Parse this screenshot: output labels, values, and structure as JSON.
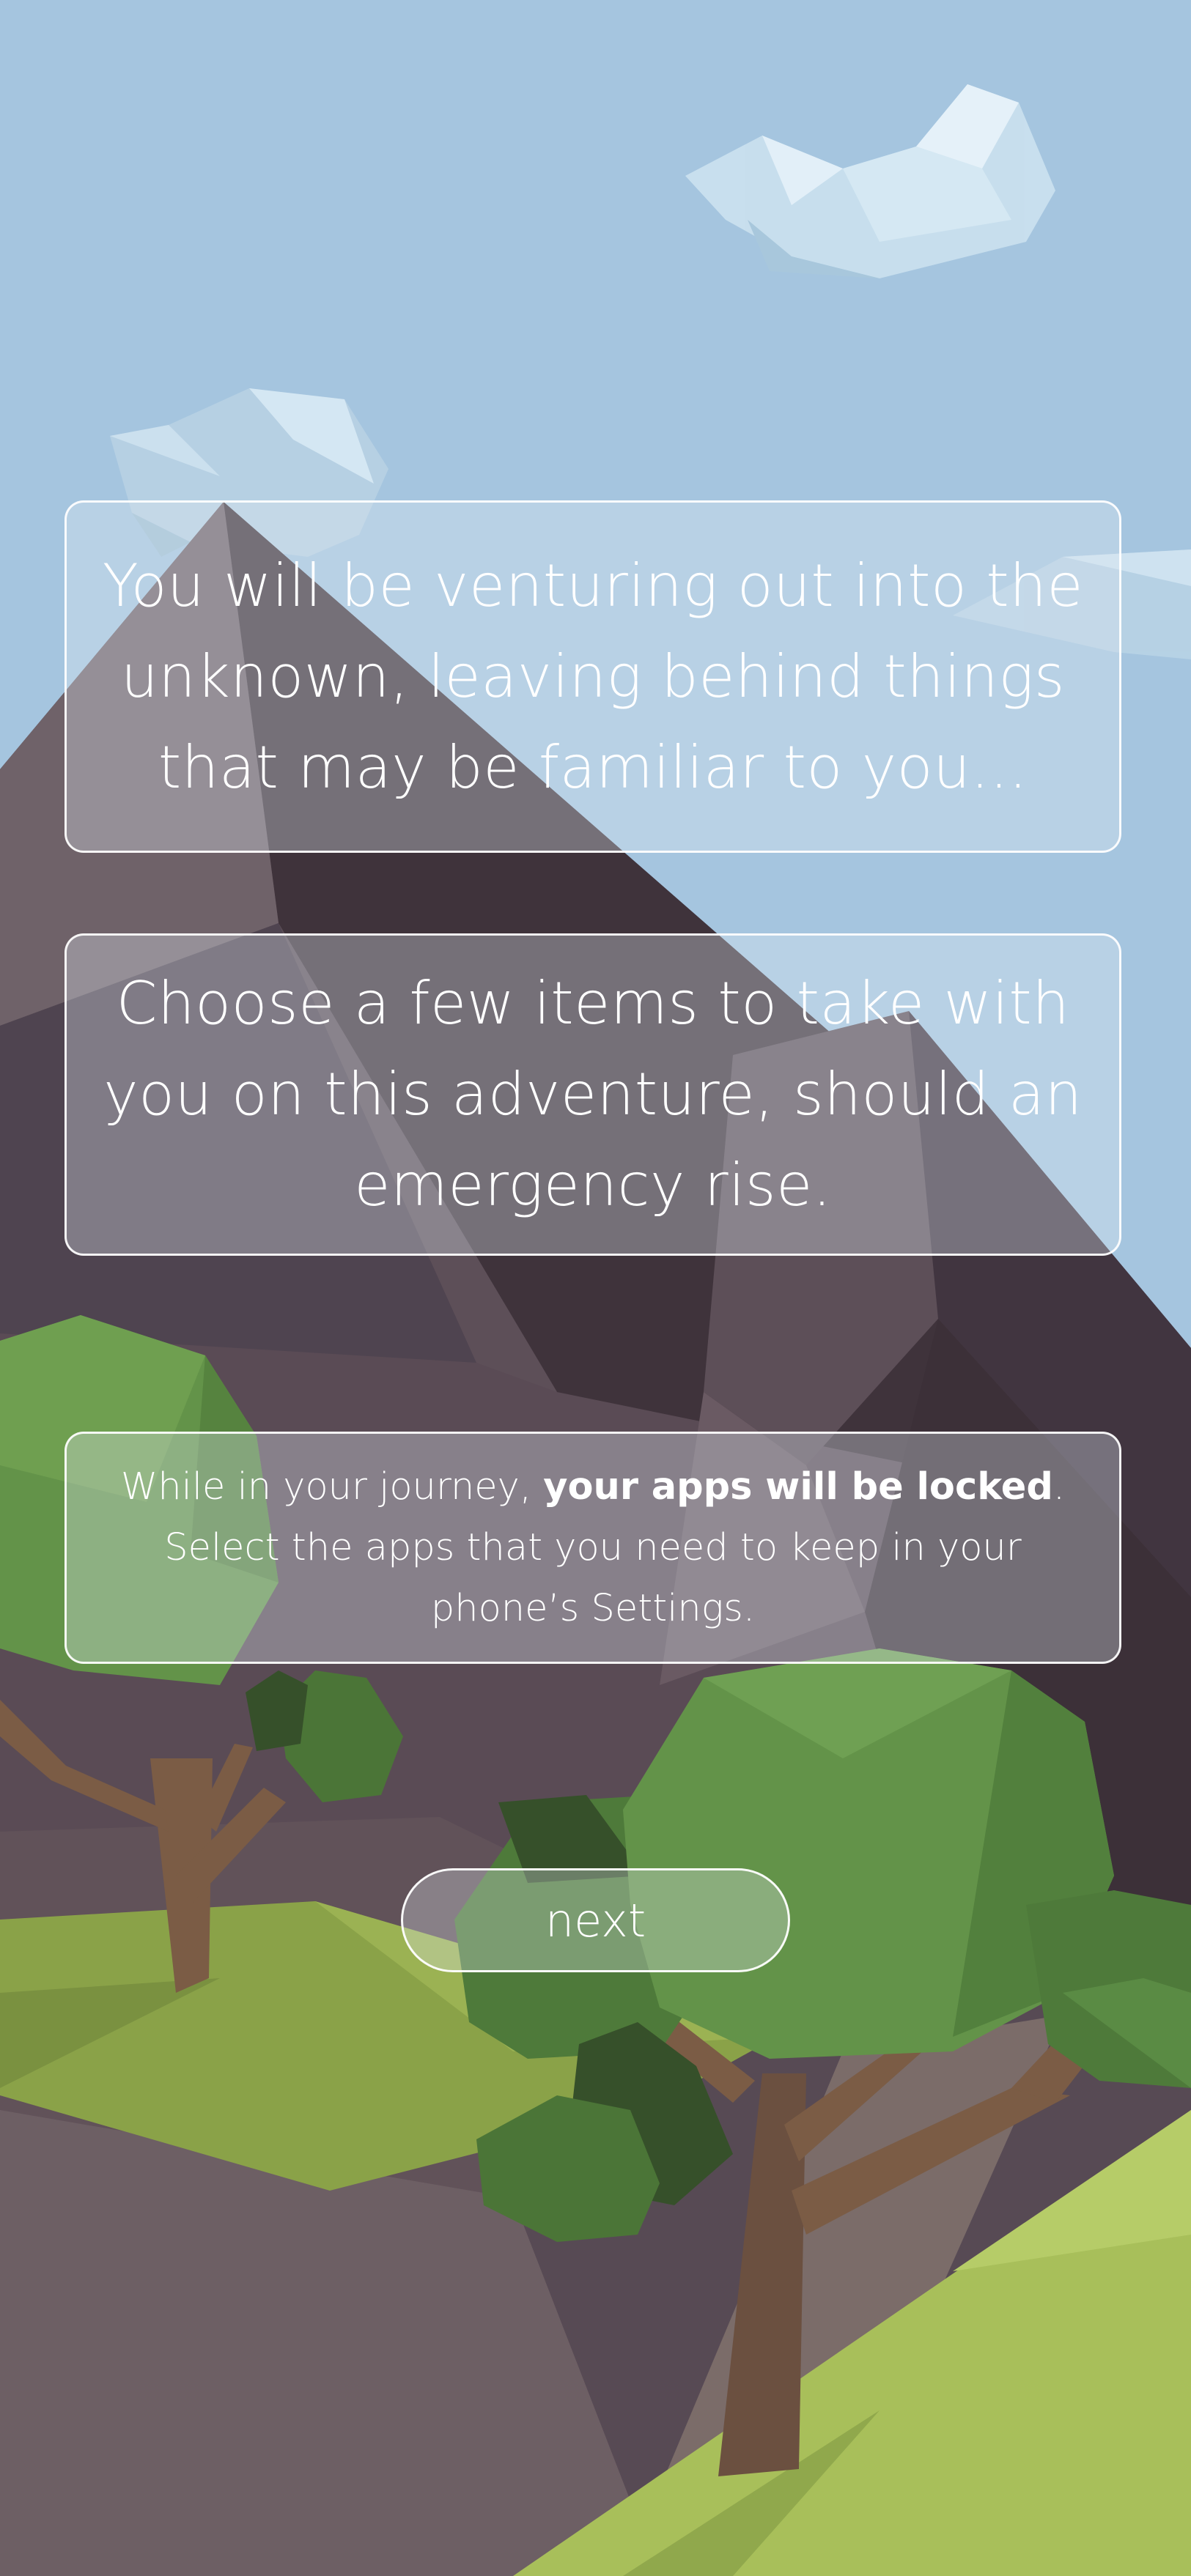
{
  "intro": {
    "line1": "You will be venturing out into the",
    "line2": "unknown, leaving behind things",
    "line3": "that may be familiar to you..."
  },
  "choose": {
    "line1": "Choose a few items to take with",
    "line2": "you on this adventure, should an",
    "line3": "emergency rise."
  },
  "notice": {
    "prefix": "While in your journey, ",
    "bold": "your apps will be locked",
    "suffix": ".",
    "line2": "Select the apps that you need to keep in your",
    "line3": "phone’s Settings."
  },
  "next_label": "next",
  "colors": {
    "sky": "#a5c5df",
    "mountain_dark": "#3f333b",
    "mountain_mid": "#5c4e57",
    "grass": "#8aa248",
    "grass_light": "#a8bf5a",
    "tree_green": "#639349",
    "trunk": "#6b5040"
  }
}
